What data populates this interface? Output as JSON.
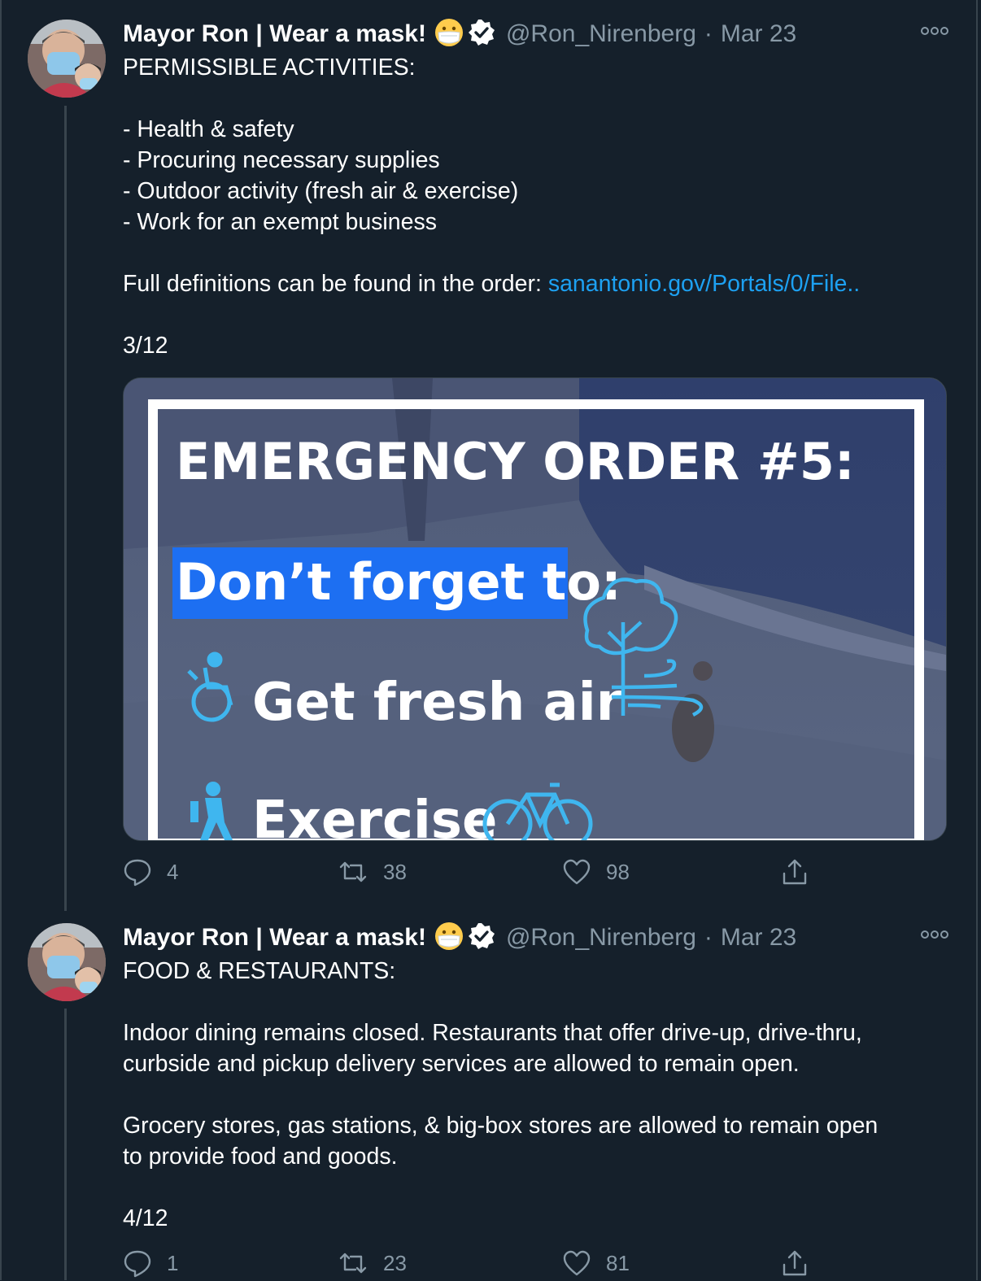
{
  "tweets": [
    {
      "display_name": "Mayor Ron | Wear a mask!",
      "handle": "@Ron_Nirenberg",
      "separator": "·",
      "date": "Mar 23",
      "lines": [
        "PERMISSIBLE ACTIVITIES:",
        "- Health & safety",
        "- Procuring necessary supplies",
        "- Outdoor activity (fresh air & exercise)",
        "- Work for an exempt business",
        "Full definitions can be found in the order: ",
        "3/12"
      ],
      "link_text": "sanantonio.gov/Portals/0/File..",
      "media": {
        "heading": "EMERGENCY ORDER #5:",
        "subheading": "Don’t forget to:",
        "item1": "Get fresh air",
        "item2": "Exercise"
      },
      "counts": {
        "replies": "4",
        "retweets": "38",
        "likes": "98"
      }
    },
    {
      "display_name": "Mayor Ron | Wear a mask!",
      "handle": "@Ron_Nirenberg",
      "separator": "·",
      "date": "Mar 23",
      "lines": [
        "FOOD & RESTAURANTS:",
        "Indoor dining remains closed. Restaurants that offer drive-up, drive-thru,",
        "curbside and pickup delivery services are allowed to remain open.",
        "Grocery stores, gas stations, & big-box stores are allowed to remain open",
        "to provide food and goods.",
        "4/12"
      ],
      "counts": {
        "replies": "1",
        "retweets": "23",
        "likes": "81"
      }
    }
  ],
  "colors": {
    "background": "#15202b",
    "secondary_text": "#8899a6",
    "link": "#1da1f2",
    "highlight": "#1d6ff2"
  },
  "icons": [
    "mask-emoji-icon",
    "verified-badge-icon",
    "more-options-icon",
    "reply-icon",
    "retweet-icon",
    "like-icon",
    "share-icon"
  ]
}
